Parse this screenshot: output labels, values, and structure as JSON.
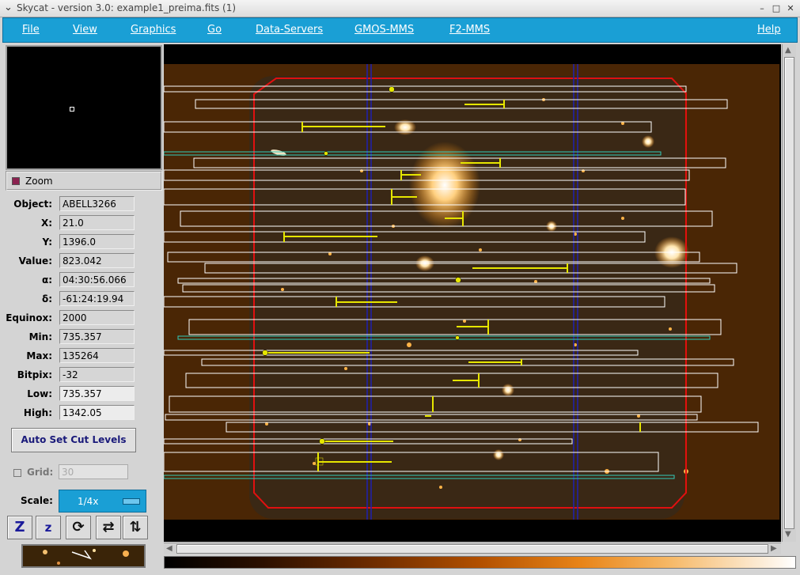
{
  "window": {
    "title": "Skycat - version 3.0: example1_preima.fits (1)",
    "buttons": [
      "–",
      "□",
      "✕"
    ]
  },
  "menubar": {
    "items": [
      "File",
      "View",
      "Graphics",
      "Go",
      "Data-Servers",
      "GMOS-MMS",
      "F2-MMS"
    ],
    "help": "Help"
  },
  "zoom": {
    "label": "Zoom"
  },
  "info": {
    "fields": [
      {
        "label": "Object:",
        "value": "ABELL3266"
      },
      {
        "label": "X:",
        "value": "21.0"
      },
      {
        "label": "Y:",
        "value": "1396.0"
      },
      {
        "label": "Value:",
        "value": "823.042"
      },
      {
        "label": "α:",
        "value": "04:30:56.066"
      },
      {
        "label": "δ:",
        "value": "-61:24:19.94"
      },
      {
        "label": "Equinox:",
        "value": "2000"
      },
      {
        "label": "Min:",
        "value": "735.357"
      },
      {
        "label": "Max:",
        "value": "135264"
      },
      {
        "label": "Bitpix:",
        "value": "-32"
      },
      {
        "label": "Low:",
        "value": "735.357"
      },
      {
        "label": "High:",
        "value": "1342.05"
      }
    ]
  },
  "controls": {
    "auto_cut_label": "Auto Set Cut Levels",
    "grid_label": "Grid:",
    "grid_value": "30",
    "scale_label": "Scale:",
    "scale_value": "1/4x"
  },
  "toolbar": {
    "buttons": [
      {
        "glyph": "Z",
        "icon": "zoom-in-icon"
      },
      {
        "glyph": "z",
        "icon": "zoom-out-icon"
      },
      {
        "glyph": "⟳",
        "icon": "rotate-icon"
      },
      {
        "glyph": "⇄",
        "icon": "flip-x-icon"
      },
      {
        "glyph": "⇅",
        "icon": "flip-y-icon"
      }
    ]
  },
  "colors": {
    "menubar": "#1a9fd5",
    "slit": "#ffffff",
    "slit_acq": "#33ccbb",
    "fov": "#e01010",
    "gap": "#2020b0",
    "target": "#e6e600",
    "background": "#4a2605"
  }
}
